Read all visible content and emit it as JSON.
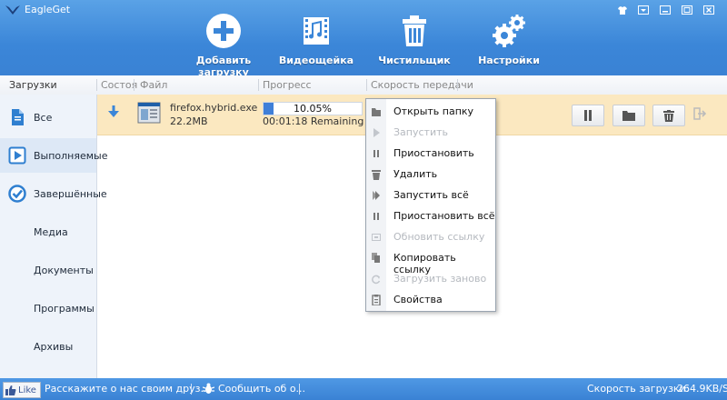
{
  "app": {
    "title": "EagleGet"
  },
  "toolbar": {
    "add_download": "Добавить загрузку",
    "video_sniffer": "Видеощейка",
    "cleaner": "Чистильщик",
    "settings": "Настройки"
  },
  "columns": {
    "downloads": "Загрузки",
    "status": "Состоя",
    "file": "Файл",
    "progress": "Прогресс",
    "speed": "Скорость передачи"
  },
  "sidebar": {
    "items": [
      {
        "label": "Все",
        "icon": "file-icon"
      },
      {
        "label": "Выполняемые",
        "icon": "play-icon"
      },
      {
        "label": "Завершённые",
        "icon": "check-circle-icon"
      },
      {
        "label": "Медиа"
      },
      {
        "label": "Документы"
      },
      {
        "label": "Программы"
      },
      {
        "label": "Архивы"
      }
    ],
    "active_index": 1
  },
  "download": {
    "file_name": "firefox.hybrid.exe",
    "size": "22.2MB",
    "progress_text": "10.05%",
    "progress": 0.1005,
    "remaining": "00:01:18 Remaining",
    "row_color": "#fbe8c0"
  },
  "context_menu": {
    "items": [
      {
        "label": "Открыть папку",
        "icon": "folder-icon",
        "enabled": true
      },
      {
        "label": "Запустить",
        "icon": "play-icon",
        "enabled": false
      },
      {
        "label": "Приостановить",
        "icon": "pause-icon",
        "enabled": true
      },
      {
        "label": "Удалить",
        "icon": "trash-icon",
        "enabled": true
      },
      {
        "label": "Запустить всё",
        "icon": "play-all-icon",
        "enabled": true
      },
      {
        "label": "Приостановить всё",
        "icon": "pause-all-icon",
        "enabled": true
      },
      {
        "label": "Обновить ссылку",
        "icon": "refresh-link-icon",
        "enabled": false
      },
      {
        "label": "Копировать ссылку",
        "icon": "copy-icon",
        "enabled": true
      },
      {
        "label": "Загрузить заново",
        "icon": "reload-icon",
        "enabled": false
      },
      {
        "label": "Свойства",
        "icon": "properties-icon",
        "enabled": true
      }
    ]
  },
  "footer": {
    "like": "Like",
    "share": "Расскажите о нас своим друз...",
    "report": "Сообщить об о...",
    "speed_label": "Скорость загрузки:",
    "speed_value": "264.9KB/S"
  },
  "colors": {
    "accent": "#3b86d8",
    "highlight": "#fbe8c0"
  }
}
